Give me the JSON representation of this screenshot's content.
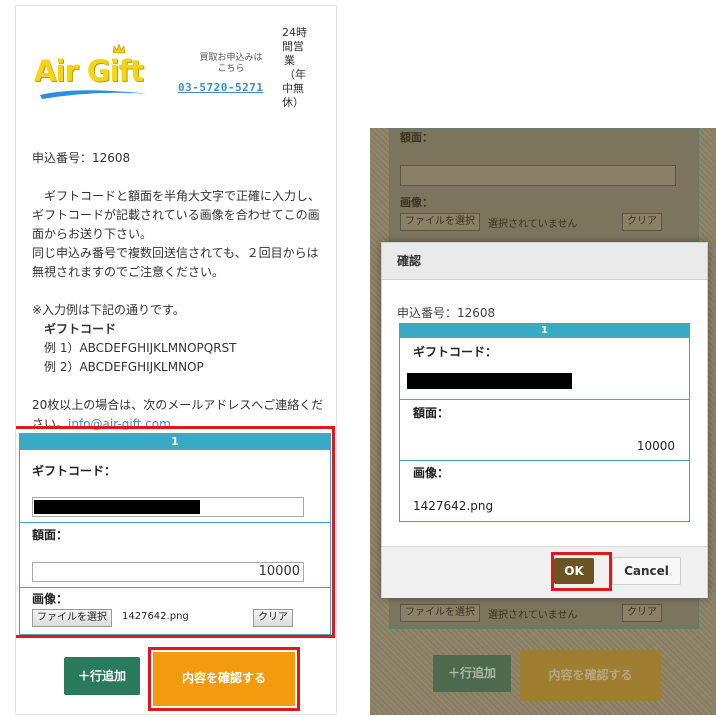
{
  "header": {
    "logo_text": "Air Gift",
    "small_text": "買取お申込みはこちら",
    "phone": "03-5720-5271",
    "hours_lines": [
      "24時",
      "間営",
      "業",
      "（年",
      "中無",
      "休）"
    ]
  },
  "application_number": "申込番号：12608",
  "instructions": {
    "paragraph1": "　ギフトコードと額面を半角大文字で正確に入力し、ギフトコードが記載されている画像を合わせてこの画面からお送り下さい。",
    "paragraph2": "同じ申込み番号で複数回送信されても、２回目からは無視されますのでご注意ください。",
    "example_intro": "※入力例は下記の通りです。",
    "example_heading": "ギフトコード",
    "example1": "例 1）ABCDEFGHIJKLMNOPQRST",
    "example2": "例 2）ABCDEFGHIJKLMNOP",
    "bulk_note": "20枚以上の場合は、次のメールアドレスへご連絡ください。",
    "email": "info@air-gift.com"
  },
  "form": {
    "row_number": "1",
    "gift_code_label": "ギフトコード：",
    "amount_label": "額面：",
    "amount_value": "10000",
    "image_label": "画像：",
    "file_button": "ファイルを選択",
    "file_name": "1427642.png",
    "clear_button": "クリア",
    "add_row_button": "＋行追加",
    "confirm_button": "内容を確認する"
  },
  "background_form": {
    "amount_label": "額面：",
    "image_label": "画像：",
    "file_button": "ファイルを選択",
    "no_file": "選択されていません",
    "clear_button": "クリア",
    "add_row_button": "＋行追加",
    "confirm_button": "内容を確認する"
  },
  "modal": {
    "title": "確認",
    "application_number": "申込番号：12608",
    "row_number": "1",
    "gift_code_label": "ギフトコード：",
    "amount_label": "額面：",
    "amount_value": "10000",
    "image_label": "画像：",
    "image_value": "1427642.png",
    "ok_button": "OK",
    "cancel_button": "Cancel"
  },
  "colors": {
    "accent_teal": "#3aa9c4",
    "highlight_red": "#e0171c",
    "confirm_orange": "#f39b0c",
    "add_green": "#2a7a5c",
    "ok_brown": "#6a5424",
    "logo_yellow": "#f3d418",
    "link_blue": "#3a8fd2"
  }
}
